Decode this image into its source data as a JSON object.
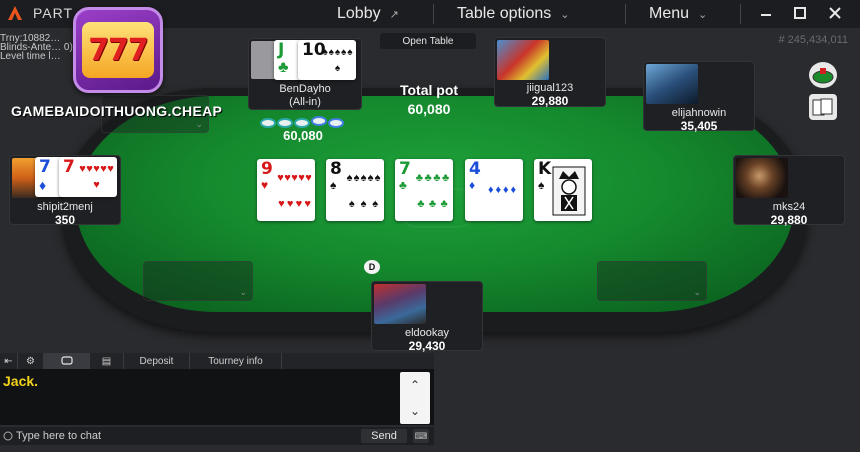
{
  "titlebar": {
    "title": "PART… …",
    "lobby_label": "Lobby",
    "lobby_icon": "external-link-icon",
    "table_options_label": "Table options",
    "menu_label": "Menu",
    "dropdown_glyph": "⌄",
    "external_glyph": "↗"
  },
  "info": {
    "line1": "Trny:10882…",
    "line2": "Blinds-Ante…           0)",
    "line3": "Level time l…"
  },
  "hand_id": "# 245,434,011",
  "overlay": {
    "slot_text": "777",
    "site": "GAMEBAIDOITHUONG.CHEAP"
  },
  "open_table": "Open Table",
  "pot": {
    "label": "Total pot",
    "value": "60,080"
  },
  "bet": {
    "amount": "60,080"
  },
  "dealer_label": "D",
  "seats": {
    "bendayho": {
      "name": "BenDayho",
      "status": "(All-in)",
      "cards": [
        {
          "rank": "J",
          "suit": "♣",
          "color": "green"
        },
        {
          "rank": "10",
          "suit": "♠",
          "color": "black"
        }
      ]
    },
    "jiigual": {
      "name": "jiigual123",
      "stack": "29,880"
    },
    "elijah": {
      "name": "elijahnowin",
      "stack": "35,405"
    },
    "shipit": {
      "name": "shipit2menj",
      "stack": "350",
      "cards": [
        {
          "rank": "7",
          "suit": "♦",
          "color": "blue"
        },
        {
          "rank": "7",
          "suit": "♥",
          "color": "red"
        }
      ]
    },
    "mks": {
      "name": "mks24",
      "stack": "29,880"
    },
    "eldookay": {
      "name": "eldookay",
      "stack": "29,430"
    }
  },
  "board": [
    {
      "rank": "9",
      "suit": "♥",
      "color": "red",
      "pips": 9
    },
    {
      "rank": "8",
      "suit": "♠",
      "color": "black",
      "pips": 8
    },
    {
      "rank": "7",
      "suit": "♣",
      "color": "green",
      "pips": 7
    },
    {
      "rank": "4",
      "suit": "♦",
      "color": "blue",
      "pips": 4
    },
    {
      "rank": "K",
      "suit": "♠",
      "color": "black",
      "pips": 0
    }
  ],
  "chat": {
    "tabs": {
      "deposit": "Deposit",
      "tourney_info": "Tourney info"
    },
    "message": "Jack.",
    "placeholder": "Type here to chat",
    "send_label": "Send"
  },
  "colors": {
    "felt": "#158a2e",
    "chat_text": "#f2d21a",
    "titlebar": "#1c1d20"
  }
}
